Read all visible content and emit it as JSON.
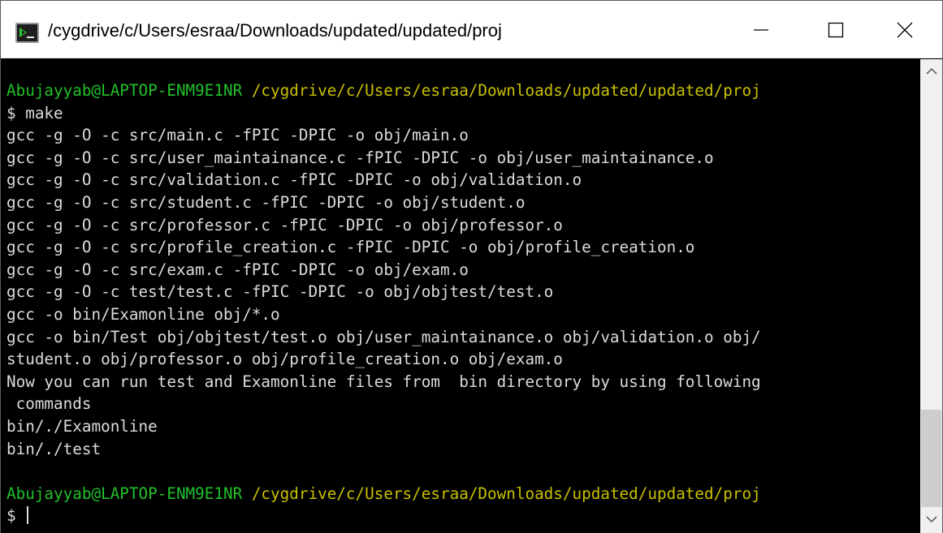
{
  "window": {
    "title": "/cygdrive/c/Users/esraa/Downloads/updated/updated/proj",
    "icon": "cygwin-terminal-icon",
    "buttons": {
      "minimize_icon": "minimize-icon",
      "maximize_icon": "maximize-icon",
      "close_icon": "close-icon"
    }
  },
  "terminal": {
    "prompt1": {
      "user": "Abujayyab@LAPTOP-ENM9E1NR",
      "path": "/cygdrive/c/Users/esraa/Downloads/updated/updated/proj"
    },
    "output": [
      "$ make",
      "gcc -g -O -c src/main.c -fPIC -DPIC -o obj/main.o",
      "gcc -g -O -c src/user_maintainance.c -fPIC -DPIC -o obj/user_maintainance.o",
      "gcc -g -O -c src/validation.c -fPIC -DPIC -o obj/validation.o",
      "gcc -g -O -c src/student.c -fPIC -DPIC -o obj/student.o",
      "gcc -g -O -c src/professor.c -fPIC -DPIC -o obj/professor.o",
      "gcc -g -O -c src/profile_creation.c -fPIC -DPIC -o obj/profile_creation.o",
      "gcc -g -O -c src/exam.c -fPIC -DPIC -o obj/exam.o",
      "gcc -g -O -c test/test.c -fPIC -DPIC -o obj/objtest/test.o",
      "gcc -o bin/Examonline obj/*.o",
      "gcc -o bin/Test obj/objtest/test.o obj/user_maintainance.o obj/validation.o obj/",
      "student.o obj/professor.o obj/profile_creation.o obj/exam.o",
      "Now you can run test and Examonline files from  bin directory by using following",
      " commands",
      "bin/./Examonline",
      "bin/./test",
      ""
    ],
    "prompt2": {
      "user": "Abujayyab@LAPTOP-ENM9E1NR",
      "path": "/cygdrive/c/Users/esraa/Downloads/updated/updated/proj"
    },
    "input_line": "$ "
  },
  "colors": {
    "background": "#000000",
    "text": "#dcdcdc",
    "user": "#22c02a",
    "path": "#c8c000"
  }
}
